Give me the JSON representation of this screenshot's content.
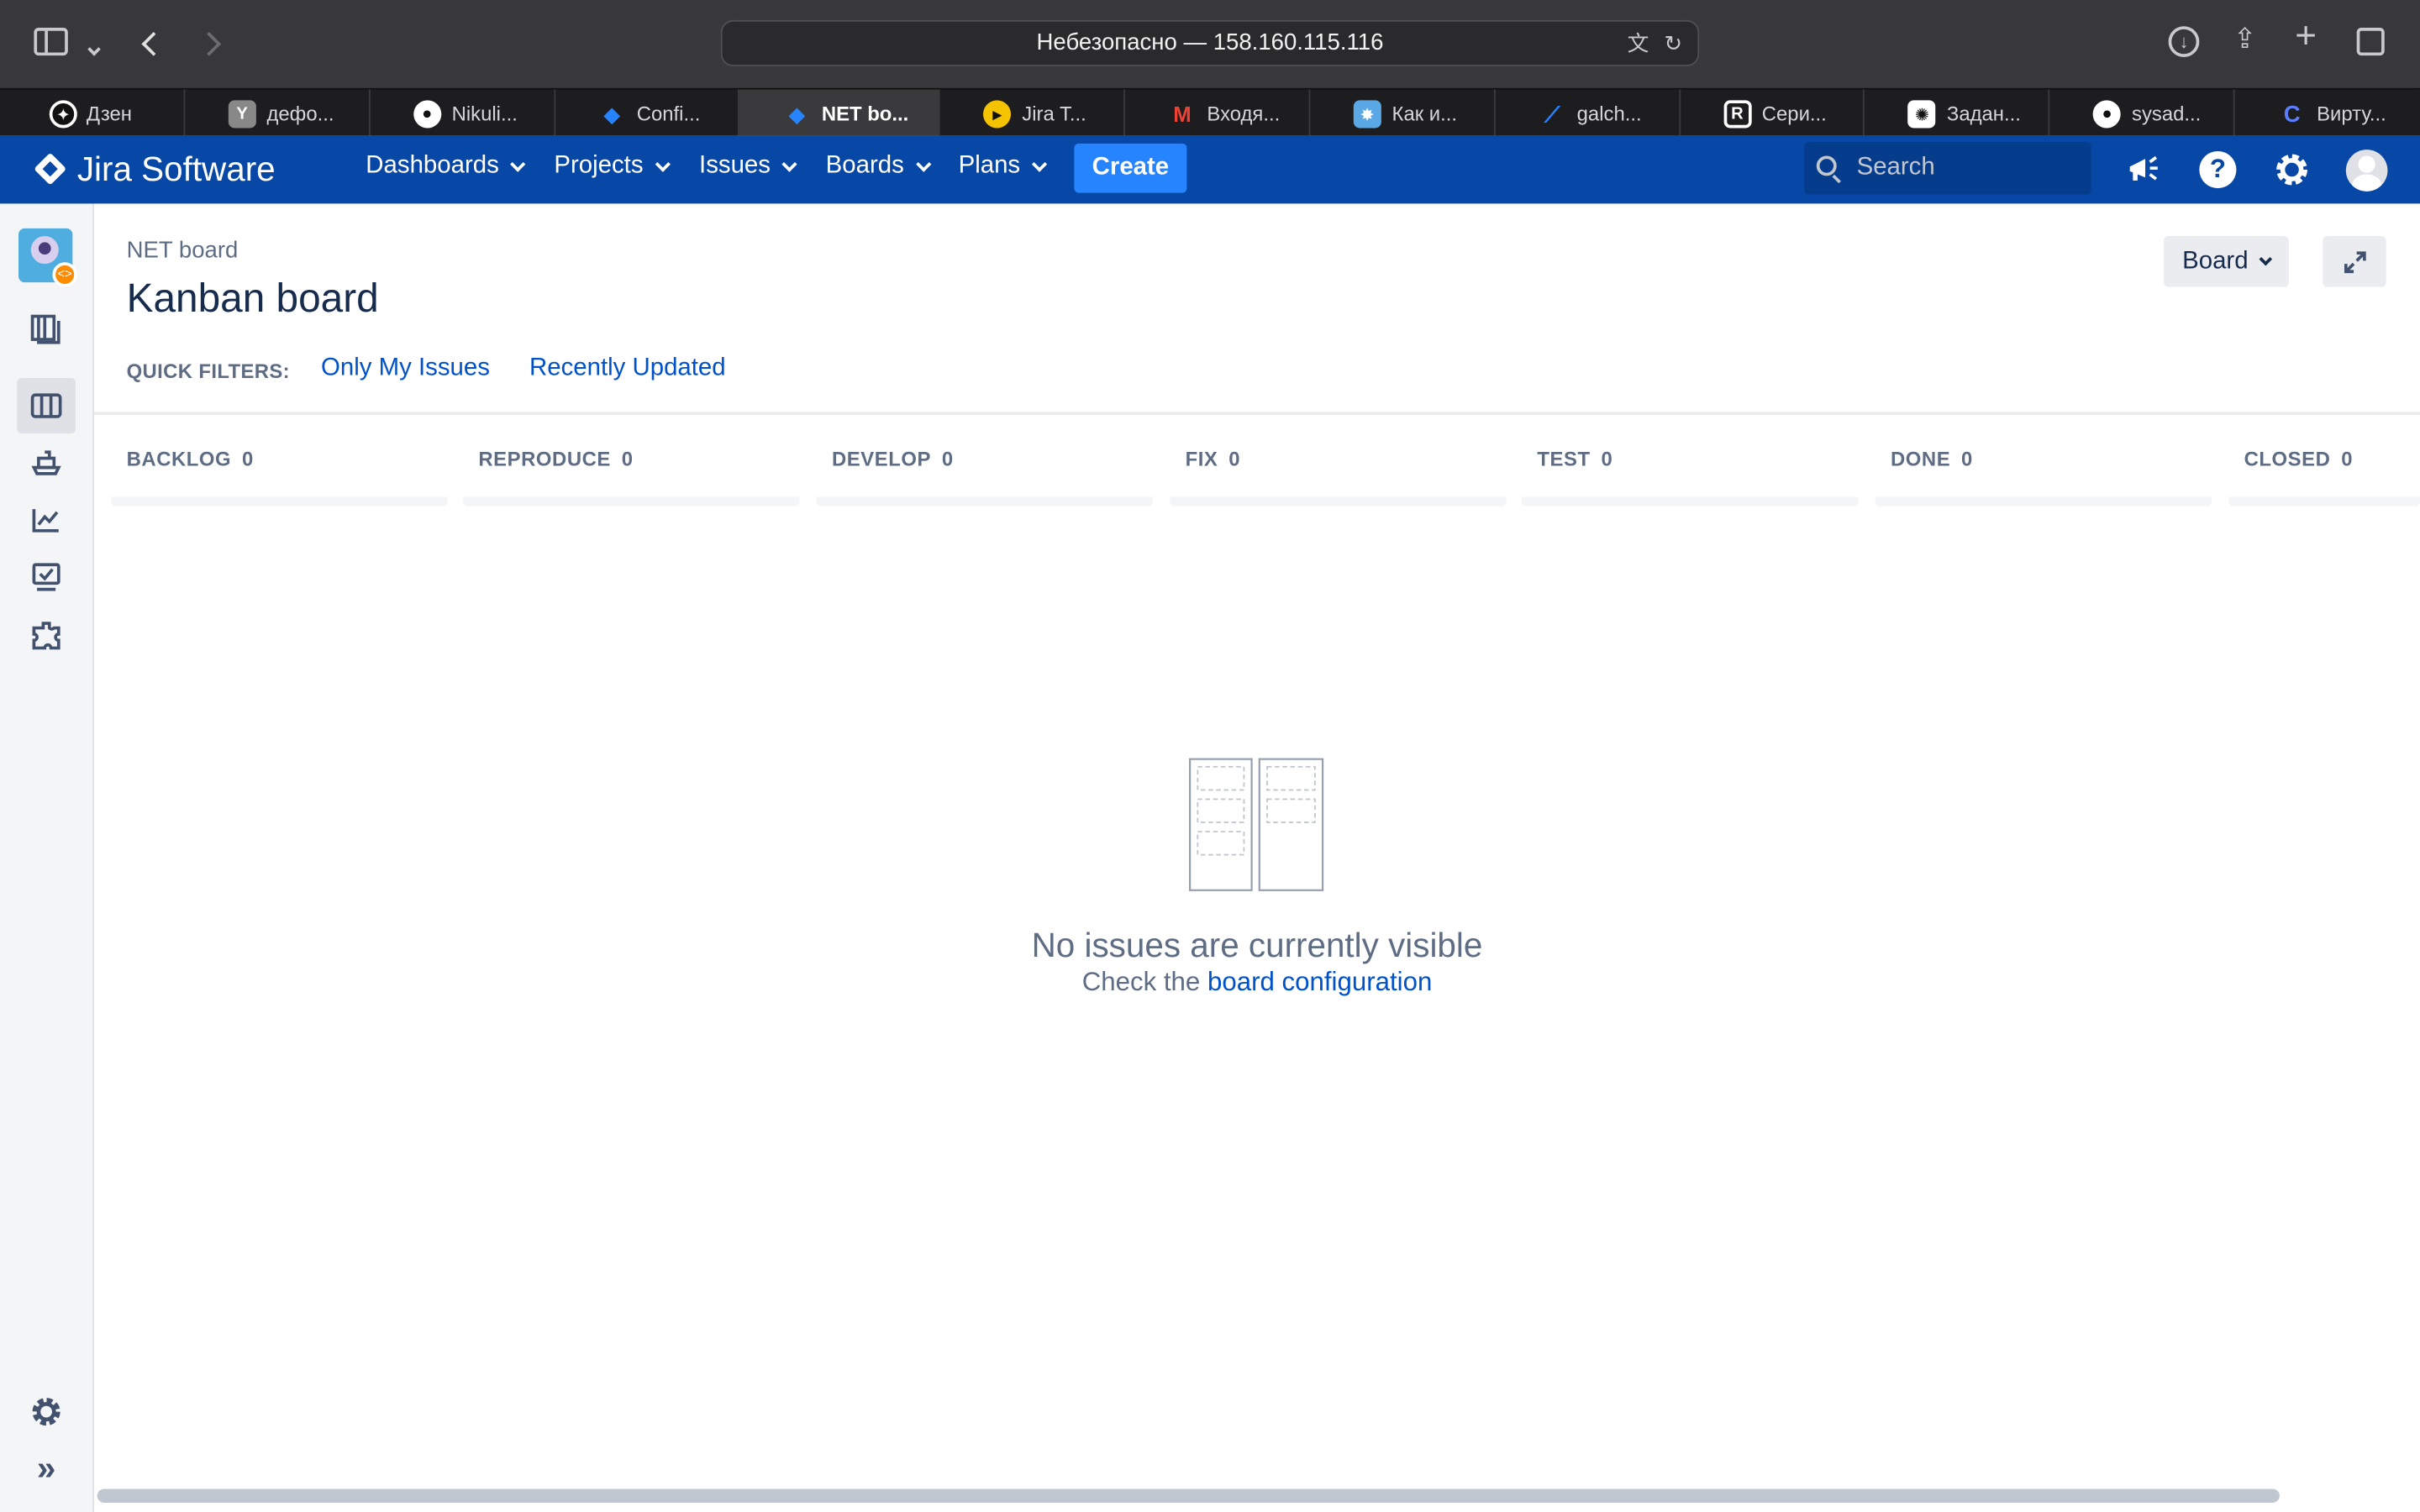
{
  "browser": {
    "address": "Небезопасно — 158.160.115.116",
    "tabs": [
      {
        "label": "Дзен",
        "icon": "zen-icon",
        "color": "#111111"
      },
      {
        "label": "дефо...",
        "icon": "yandex-icon",
        "color": "#888888"
      },
      {
        "label": "Nikuli...",
        "icon": "github-icon",
        "color": "#ffffff"
      },
      {
        "label": "Confi...",
        "icon": "confluence-icon",
        "color": "#2684ff"
      },
      {
        "label": "NET bo...",
        "icon": "jira-icon",
        "color": "#2684ff",
        "active": true
      },
      {
        "label": "Jira T...",
        "icon": "play-icon",
        "color": "#f5c400"
      },
      {
        "label": "Входя...",
        "icon": "gmail-icon",
        "color": "#ea4335"
      },
      {
        "label": "Как и...",
        "icon": "site-icon",
        "color": "#5aa9e6"
      },
      {
        "label": "galch...",
        "icon": "bitbucket-icon",
        "color": "#2684ff"
      },
      {
        "label": "Сери...",
        "icon": "r-icon",
        "color": "#222222"
      },
      {
        "label": "Задан...",
        "icon": "openai-icon",
        "color": "#ffffff"
      },
      {
        "label": "sysad...",
        "icon": "github-icon",
        "color": "#ffffff"
      },
      {
        "label": "Вирту...",
        "icon": "cloud-icon",
        "color": "#3b5bdb"
      }
    ]
  },
  "nav": {
    "product": "Jira Software",
    "items": [
      "Dashboards",
      "Projects",
      "Issues",
      "Boards",
      "Plans"
    ],
    "create": "Create",
    "search_placeholder": "Search",
    "brand_color": "#0747a6",
    "create_color": "#2684ff"
  },
  "board": {
    "breadcrumb": "NET board",
    "title": "Kanban board",
    "quick_filters_label": "QUICK FILTERS:",
    "quick_filters": [
      "Only My Issues",
      "Recently Updated"
    ],
    "board_button": "Board",
    "columns": [
      {
        "name": "BACKLOG",
        "count": "0"
      },
      {
        "name": "REPRODUCE",
        "count": "0"
      },
      {
        "name": "DEVELOP",
        "count": "0"
      },
      {
        "name": "FIX",
        "count": "0"
      },
      {
        "name": "TEST",
        "count": "0"
      },
      {
        "name": "DONE",
        "count": "0"
      },
      {
        "name": "CLOSED",
        "count": "0"
      }
    ],
    "empty_title": "No issues are currently visible",
    "empty_prefix": "Check the",
    "empty_link": "board configuration"
  }
}
